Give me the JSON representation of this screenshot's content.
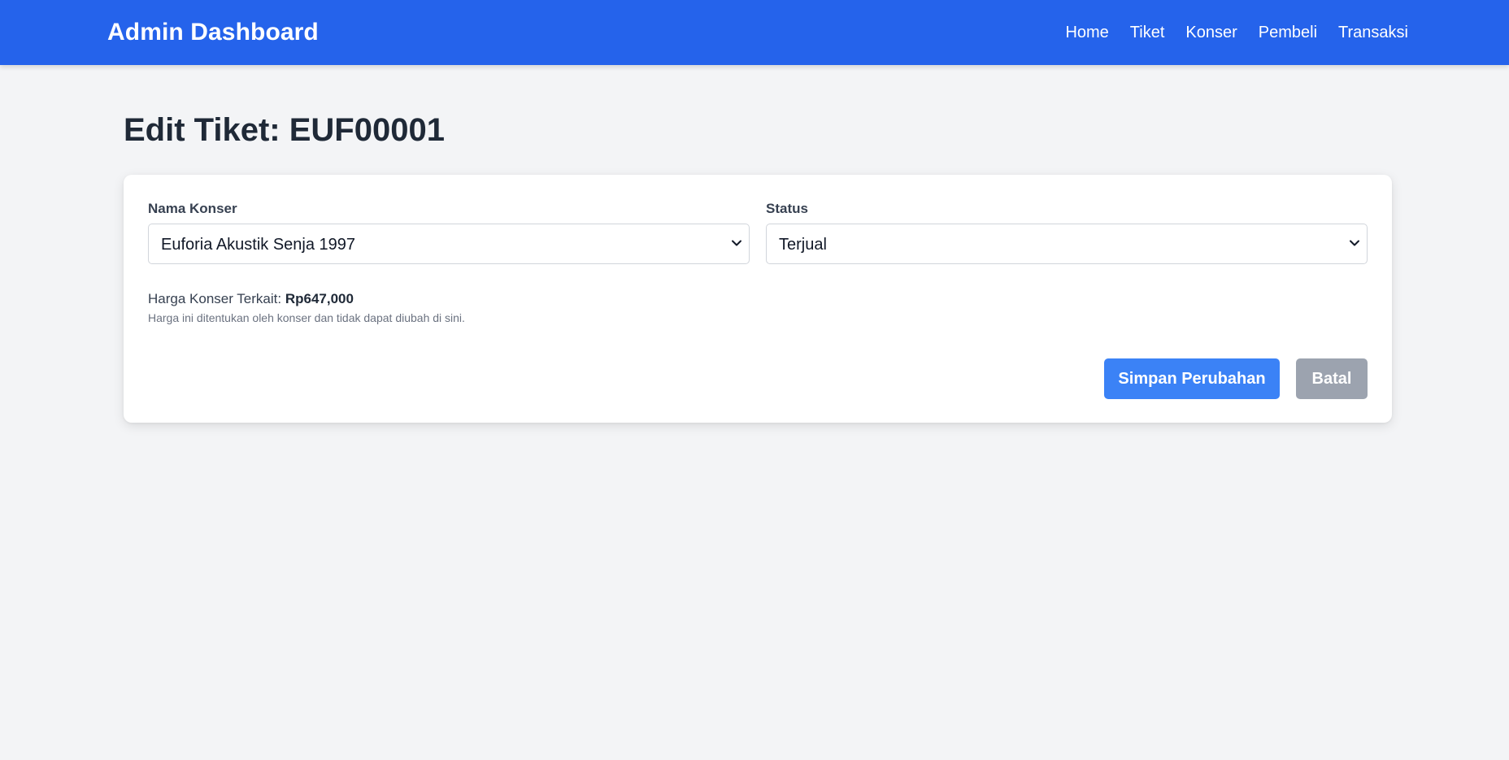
{
  "navbar": {
    "brand": "Admin Dashboard",
    "links": [
      "Home",
      "Tiket",
      "Konser",
      "Pembeli",
      "Transaksi"
    ]
  },
  "page": {
    "title": "Edit Tiket: EUF00001"
  },
  "form": {
    "concert": {
      "label": "Nama Konser",
      "value": "Euforia Akustik Senja 1997"
    },
    "status": {
      "label": "Status",
      "value": "Terjual"
    },
    "price": {
      "label": "Harga Konser Terkait:",
      "value": "Rp647,000",
      "note": "Harga ini ditentukan oleh konser dan tidak dapat diubah di sini."
    },
    "save_label": "Simpan Perubahan",
    "cancel_label": "Batal"
  },
  "colors": {
    "navbar": "#2563eb",
    "primary_button": "#3b82f6",
    "secondary_button": "#9ca3af",
    "background": "#f3f4f6"
  },
  "icons": {
    "select_arrow": "chevron-down-icon"
  }
}
